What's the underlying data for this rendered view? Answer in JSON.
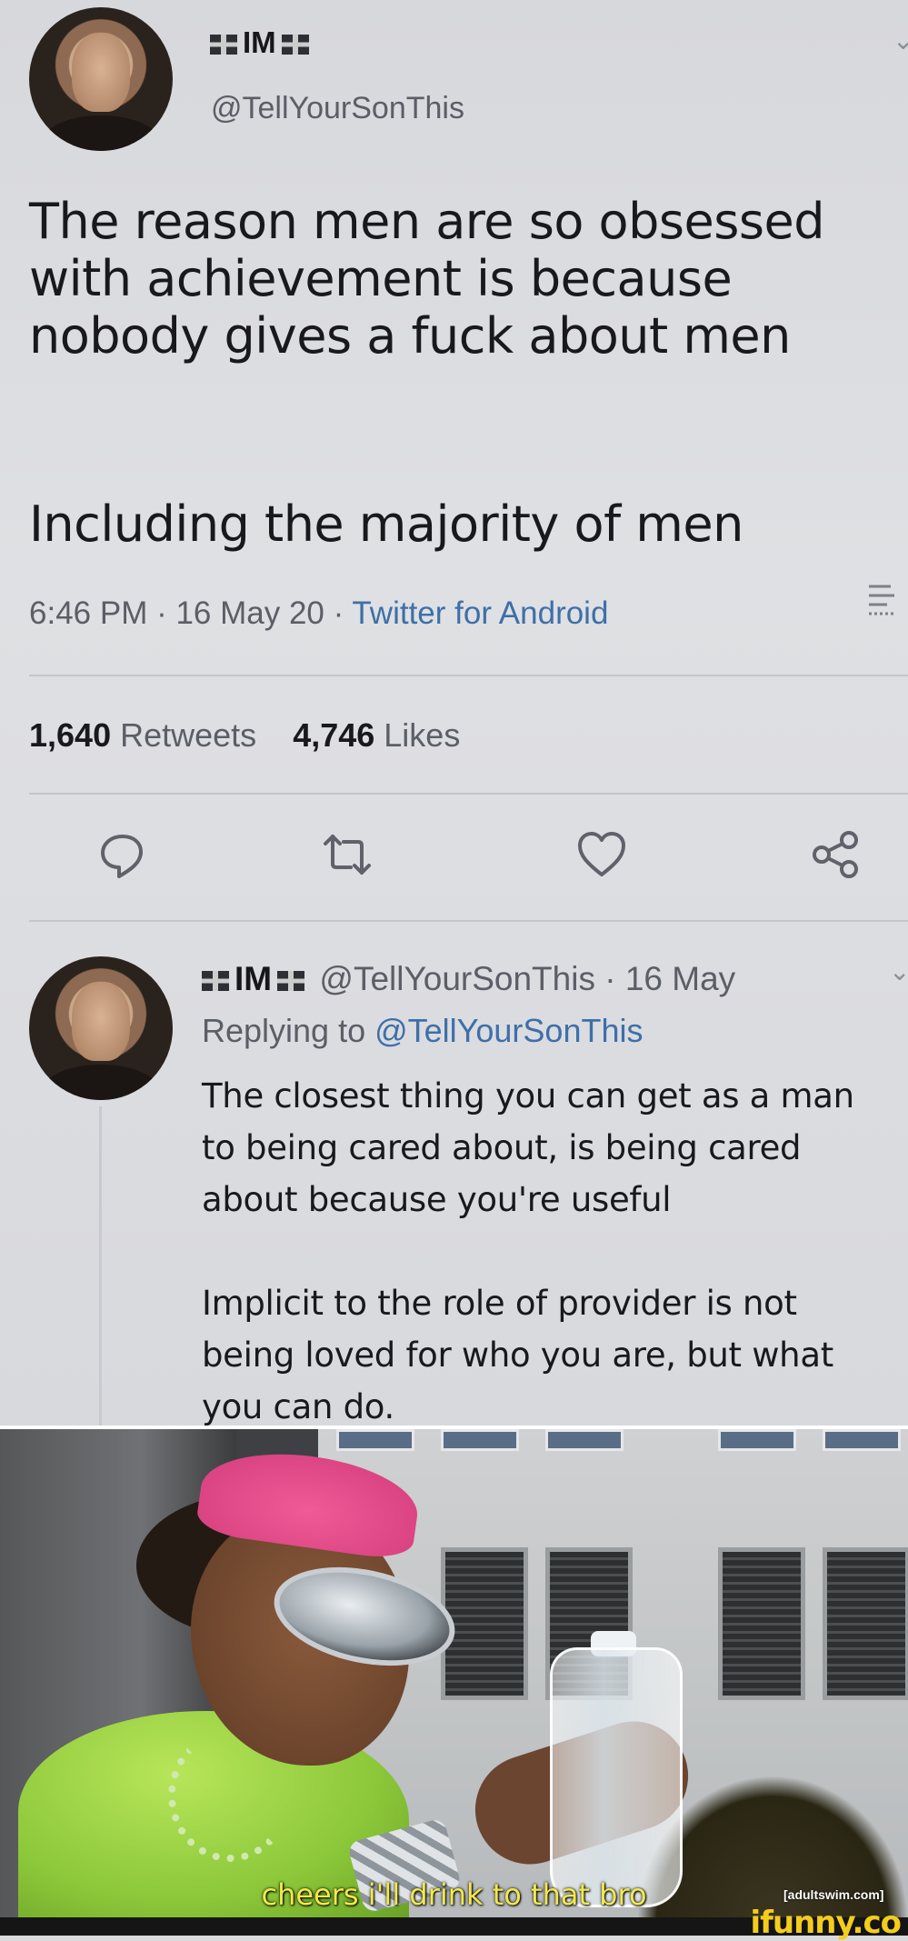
{
  "tweet": {
    "display_name": "IM",
    "handle": "@TellYourSonThis",
    "text_lines": [
      "The reason men are so obsessed",
      "with achievement is because",
      "nobody gives a fuck about men"
    ],
    "text_line_2": "Including the majority of men",
    "timestamp": "6:46 PM · 16 May 20 · ",
    "client": "Twitter for Android",
    "retweets_count": "1,640",
    "retweets_label": " Retweets",
    "likes_count": "4,746",
    "likes_label": " Likes",
    "actions": [
      "reply-icon",
      "retweet-icon",
      "like-icon",
      "share-icon"
    ]
  },
  "reply": {
    "display_name": "IM",
    "handle_date": " @TellYourSonThis · 16 May",
    "replying_prefix": "Replying to ",
    "replying_handle": "@TellYourSonThis",
    "para1_lines": [
      "The closest thing you can get as a man",
      "to being cared about, is being cared",
      "about because you're useful"
    ],
    "para2_lines": [
      "Implicit to the role of provider is not",
      "being loved for who you are, but what",
      "you can do."
    ]
  },
  "meme": {
    "subtitle": "cheers i'll drink to that bro",
    "watermark": "[adultswim.com]",
    "site_logo": "ifunny.co"
  },
  "colors": {
    "link_blue": "#3e6fa8",
    "subtitle_yellow": "#f2e94a",
    "ifunny_yellow": "#f4cd1c"
  }
}
